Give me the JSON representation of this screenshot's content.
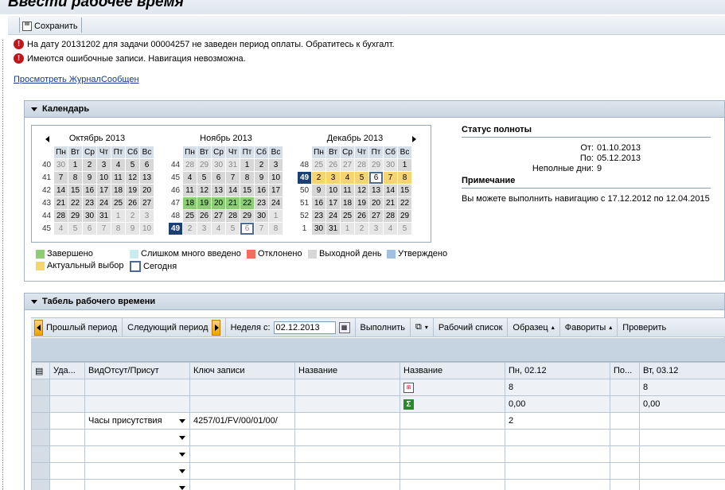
{
  "page": {
    "title": "Ввести рабочее время"
  },
  "toolbar": {
    "save_label": "Сохранить"
  },
  "messages": [
    {
      "text": "На дату 20131202 для задачи 00004257 не заведен период оплаты. Обратитесь к бухгалт."
    },
    {
      "text": "Имеются ошибочные записи. Навигация невозможна."
    }
  ],
  "journal_link": "Просмотреть ЖурналСообщен",
  "calendar": {
    "title": "Календарь",
    "weekdays": [
      "Пн",
      "Вт",
      "Ср",
      "Чт",
      "Пт",
      "Сб",
      "Вс"
    ],
    "months": [
      {
        "name": "Октябрь 2013",
        "weeks": [
          {
            "wk": "40",
            "days": [
              "30",
              "1",
              "2",
              "3",
              "4",
              "5",
              "6"
            ],
            "status": [
              "other",
              "",
              "",
              "",
              "",
              "",
              ""
            ]
          },
          {
            "wk": "41",
            "days": [
              "7",
              "8",
              "9",
              "10",
              "11",
              "12",
              "13"
            ],
            "status": [
              "",
              "",
              "",
              "",
              "",
              "",
              ""
            ]
          },
          {
            "wk": "42",
            "days": [
              "14",
              "15",
              "16",
              "17",
              "18",
              "19",
              "20"
            ],
            "status": [
              "",
              "",
              "",
              "",
              "",
              "",
              ""
            ]
          },
          {
            "wk": "43",
            "days": [
              "21",
              "22",
              "23",
              "24",
              "25",
              "26",
              "27"
            ],
            "status": [
              "",
              "",
              "",
              "",
              "",
              "",
              ""
            ]
          },
          {
            "wk": "44",
            "days": [
              "28",
              "29",
              "30",
              "31",
              "1",
              "2",
              "3"
            ],
            "status": [
              "",
              "",
              "",
              "",
              "other",
              "other",
              "other"
            ]
          },
          {
            "wk": "45",
            "days": [
              "4",
              "5",
              "6",
              "7",
              "8",
              "9",
              "10"
            ],
            "status": [
              "other",
              "other",
              "other",
              "other",
              "other",
              "other",
              "other"
            ]
          }
        ]
      },
      {
        "name": "Ноябрь 2013",
        "weeks": [
          {
            "wk": "44",
            "days": [
              "28",
              "29",
              "30",
              "31",
              "1",
              "2",
              "3"
            ],
            "status": [
              "other",
              "other",
              "other",
              "other",
              "",
              "",
              ""
            ]
          },
          {
            "wk": "45",
            "days": [
              "4",
              "5",
              "6",
              "7",
              "8",
              "9",
              "10"
            ],
            "status": [
              "",
              "",
              "",
              "",
              "",
              "",
              ""
            ]
          },
          {
            "wk": "46",
            "days": [
              "11",
              "12",
              "13",
              "14",
              "15",
              "16",
              "17"
            ],
            "status": [
              "",
              "",
              "",
              "",
              "",
              "",
              ""
            ]
          },
          {
            "wk": "47",
            "days": [
              "18",
              "19",
              "20",
              "21",
              "22",
              "23",
              "24"
            ],
            "status": [
              "done",
              "done",
              "done",
              "done",
              "done",
              "",
              ""
            ]
          },
          {
            "wk": "48",
            "days": [
              "25",
              "26",
              "27",
              "28",
              "29",
              "30",
              "1"
            ],
            "status": [
              "",
              "",
              "",
              "",
              "",
              "",
              "other"
            ]
          },
          {
            "wk": "49",
            "days": [
              "2",
              "3",
              "4",
              "5",
              "6",
              "7",
              "8"
            ],
            "status": [
              "other",
              "other",
              "other",
              "other",
              "other today",
              "other",
              "other"
            ],
            "current": true
          }
        ]
      },
      {
        "name": "Декабрь 2013",
        "weeks": [
          {
            "wk": "48",
            "days": [
              "25",
              "26",
              "27",
              "28",
              "29",
              "30",
              "1"
            ],
            "status": [
              "other",
              "other",
              "other",
              "other",
              "other",
              "other",
              ""
            ]
          },
          {
            "wk": "49",
            "days": [
              "2",
              "3",
              "4",
              "5",
              "6",
              "7",
              "8"
            ],
            "status": [
              "sel",
              "sel",
              "sel",
              "sel",
              "sel today",
              "sel",
              "sel"
            ],
            "current": true
          },
          {
            "wk": "50",
            "days": [
              "9",
              "10",
              "11",
              "12",
              "13",
              "14",
              "15"
            ],
            "status": [
              "",
              "",
              "",
              "",
              "",
              "",
              ""
            ]
          },
          {
            "wk": "51",
            "days": [
              "16",
              "17",
              "18",
              "19",
              "20",
              "21",
              "22"
            ],
            "status": [
              "",
              "",
              "",
              "",
              "",
              "",
              ""
            ]
          },
          {
            "wk": "52",
            "days": [
              "23",
              "24",
              "25",
              "26",
              "27",
              "28",
              "29"
            ],
            "status": [
              "",
              "",
              "",
              "",
              "",
              "",
              ""
            ]
          },
          {
            "wk": "1",
            "days": [
              "30",
              "31",
              "1",
              "2",
              "3",
              "4",
              "5"
            ],
            "status": [
              "",
              "",
              "other",
              "other",
              "other",
              "other",
              "other"
            ]
          }
        ]
      }
    ],
    "legend": [
      {
        "label": "Завершено",
        "color": "#8bce74"
      },
      {
        "label": "Слишком много введено",
        "color": "#c9ecef"
      },
      {
        "label": "Отклонено",
        "color": "#f26b5b"
      },
      {
        "label": "Выходной день",
        "color": "#d7d7d7"
      },
      {
        "label": "Утверждено",
        "color": "#9fbfe3"
      },
      {
        "label": "Актуальный выбор",
        "color": "#f6d470"
      },
      {
        "label": "Сегодня",
        "color": "#4f6b8d"
      }
    ]
  },
  "status": {
    "title": "Статус полноты",
    "from_label": "От:",
    "from_value": "01.10.2013",
    "to_label": "По:",
    "to_value": "05.12.2013",
    "incomplete_label": "Неполные дни:",
    "incomplete_value": "9",
    "note_title": "Примечание",
    "note_text": "Вы можете выполнить навигацию с 17.12.2012 по 12.04.2015"
  },
  "timesheet": {
    "title": "Табель рабочего времени",
    "prev_label": "Прошлый период",
    "next_label": "Следующий период",
    "week_label": "Неделя с:",
    "week_value": "02.12.2013",
    "execute_label": "Выполнить",
    "worklist_label": "Рабочий список",
    "template_label": "Образец",
    "favorites_label": "Фавориты",
    "check_label": "Проверить",
    "columns": [
      "Уда...",
      "ВидОтсут/Присут",
      "Ключ записи",
      "Название",
      "Название",
      "Пн, 02.12",
      "По...",
      "Вт, 03.12"
    ],
    "totals": {
      "mon": "8",
      "tue": "8"
    },
    "sums": {
      "mon": "0,00",
      "tue": "0,00"
    },
    "row1": {
      "type": "Часы присутствия",
      "key": "4257/01/FV/00/01/00/",
      "mon": "2"
    }
  }
}
